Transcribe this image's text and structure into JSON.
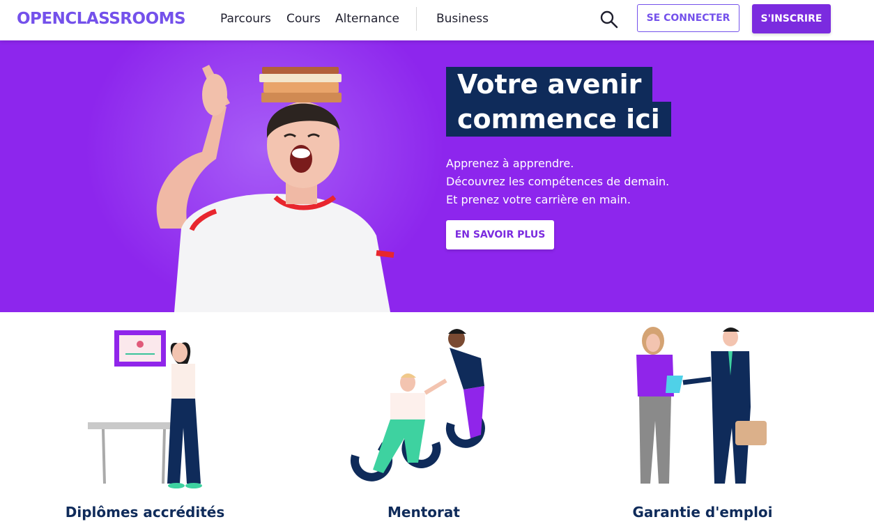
{
  "header": {
    "logo": "OPENCLASSROOMS",
    "nav": [
      "Parcours",
      "Cours",
      "Alternance",
      "Business"
    ],
    "login_label": "SE CONNECTER",
    "signup_label": "S'INSCRIRE"
  },
  "hero": {
    "title_line1": "Votre avenir",
    "title_line2": "commence ici",
    "text_lines": [
      "Apprenez à apprendre.",
      "Découvrez les compétences de demain.",
      "Et prenez votre carrière en main."
    ],
    "cta_label": "EN SAVOIR PLUS"
  },
  "features": [
    {
      "title": "Diplômes accrédités"
    },
    {
      "title": "Mentorat"
    },
    {
      "title": "Garantie d'emploi"
    }
  ],
  "colors": {
    "brand_purple": "#7b2bdf",
    "hero_bg": "#8d26ed",
    "navy": "#0f2b5a",
    "logo": "#7451eb"
  },
  "icons": [
    "search-icon"
  ]
}
